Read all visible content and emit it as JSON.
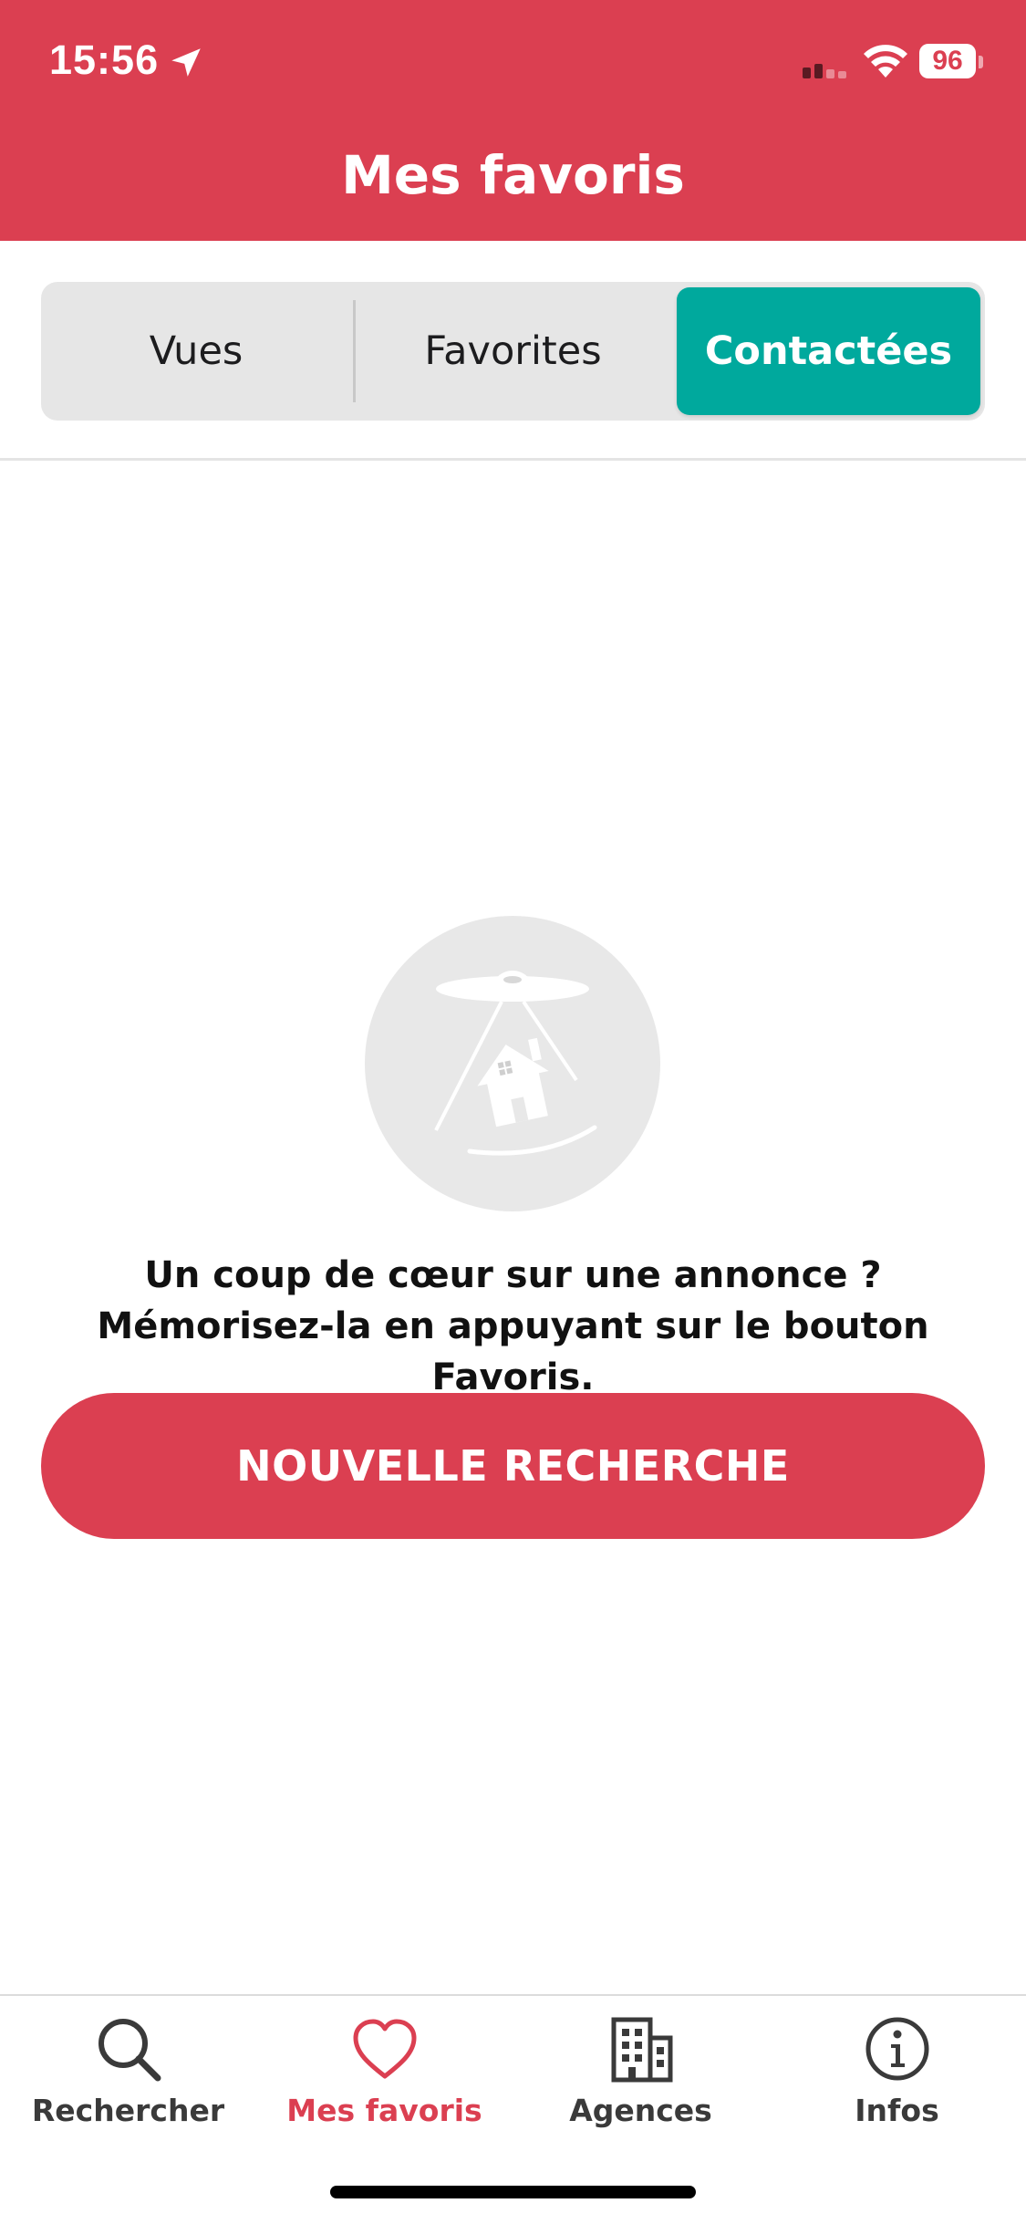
{
  "status_bar": {
    "time": "15:56",
    "battery": "96"
  },
  "header": {
    "title": "Mes favoris"
  },
  "segments": [
    {
      "label": "Vues"
    },
    {
      "label": "Favorites"
    },
    {
      "label": "Contactées",
      "selected": true
    }
  ],
  "empty_state": {
    "message": "Un coup de cœur sur une annonce ? Mémorisez-la en appuyant sur le bouton Favoris.",
    "button_label": "NOUVELLE RECHERCHE",
    "illustration_icon": "ufo-abducting-house-icon"
  },
  "tab_bar": {
    "items": [
      {
        "label": "Rechercher",
        "icon": "search-icon"
      },
      {
        "label": "Mes favoris",
        "icon": "heart-icon",
        "active": true
      },
      {
        "label": "Agences",
        "icon": "building-icon"
      },
      {
        "label": "Infos",
        "icon": "info-icon"
      }
    ]
  },
  "colors": {
    "brand_red": "#db3f51",
    "accent_teal": "#00a99d",
    "segment_bg": "#e6e6e6"
  }
}
